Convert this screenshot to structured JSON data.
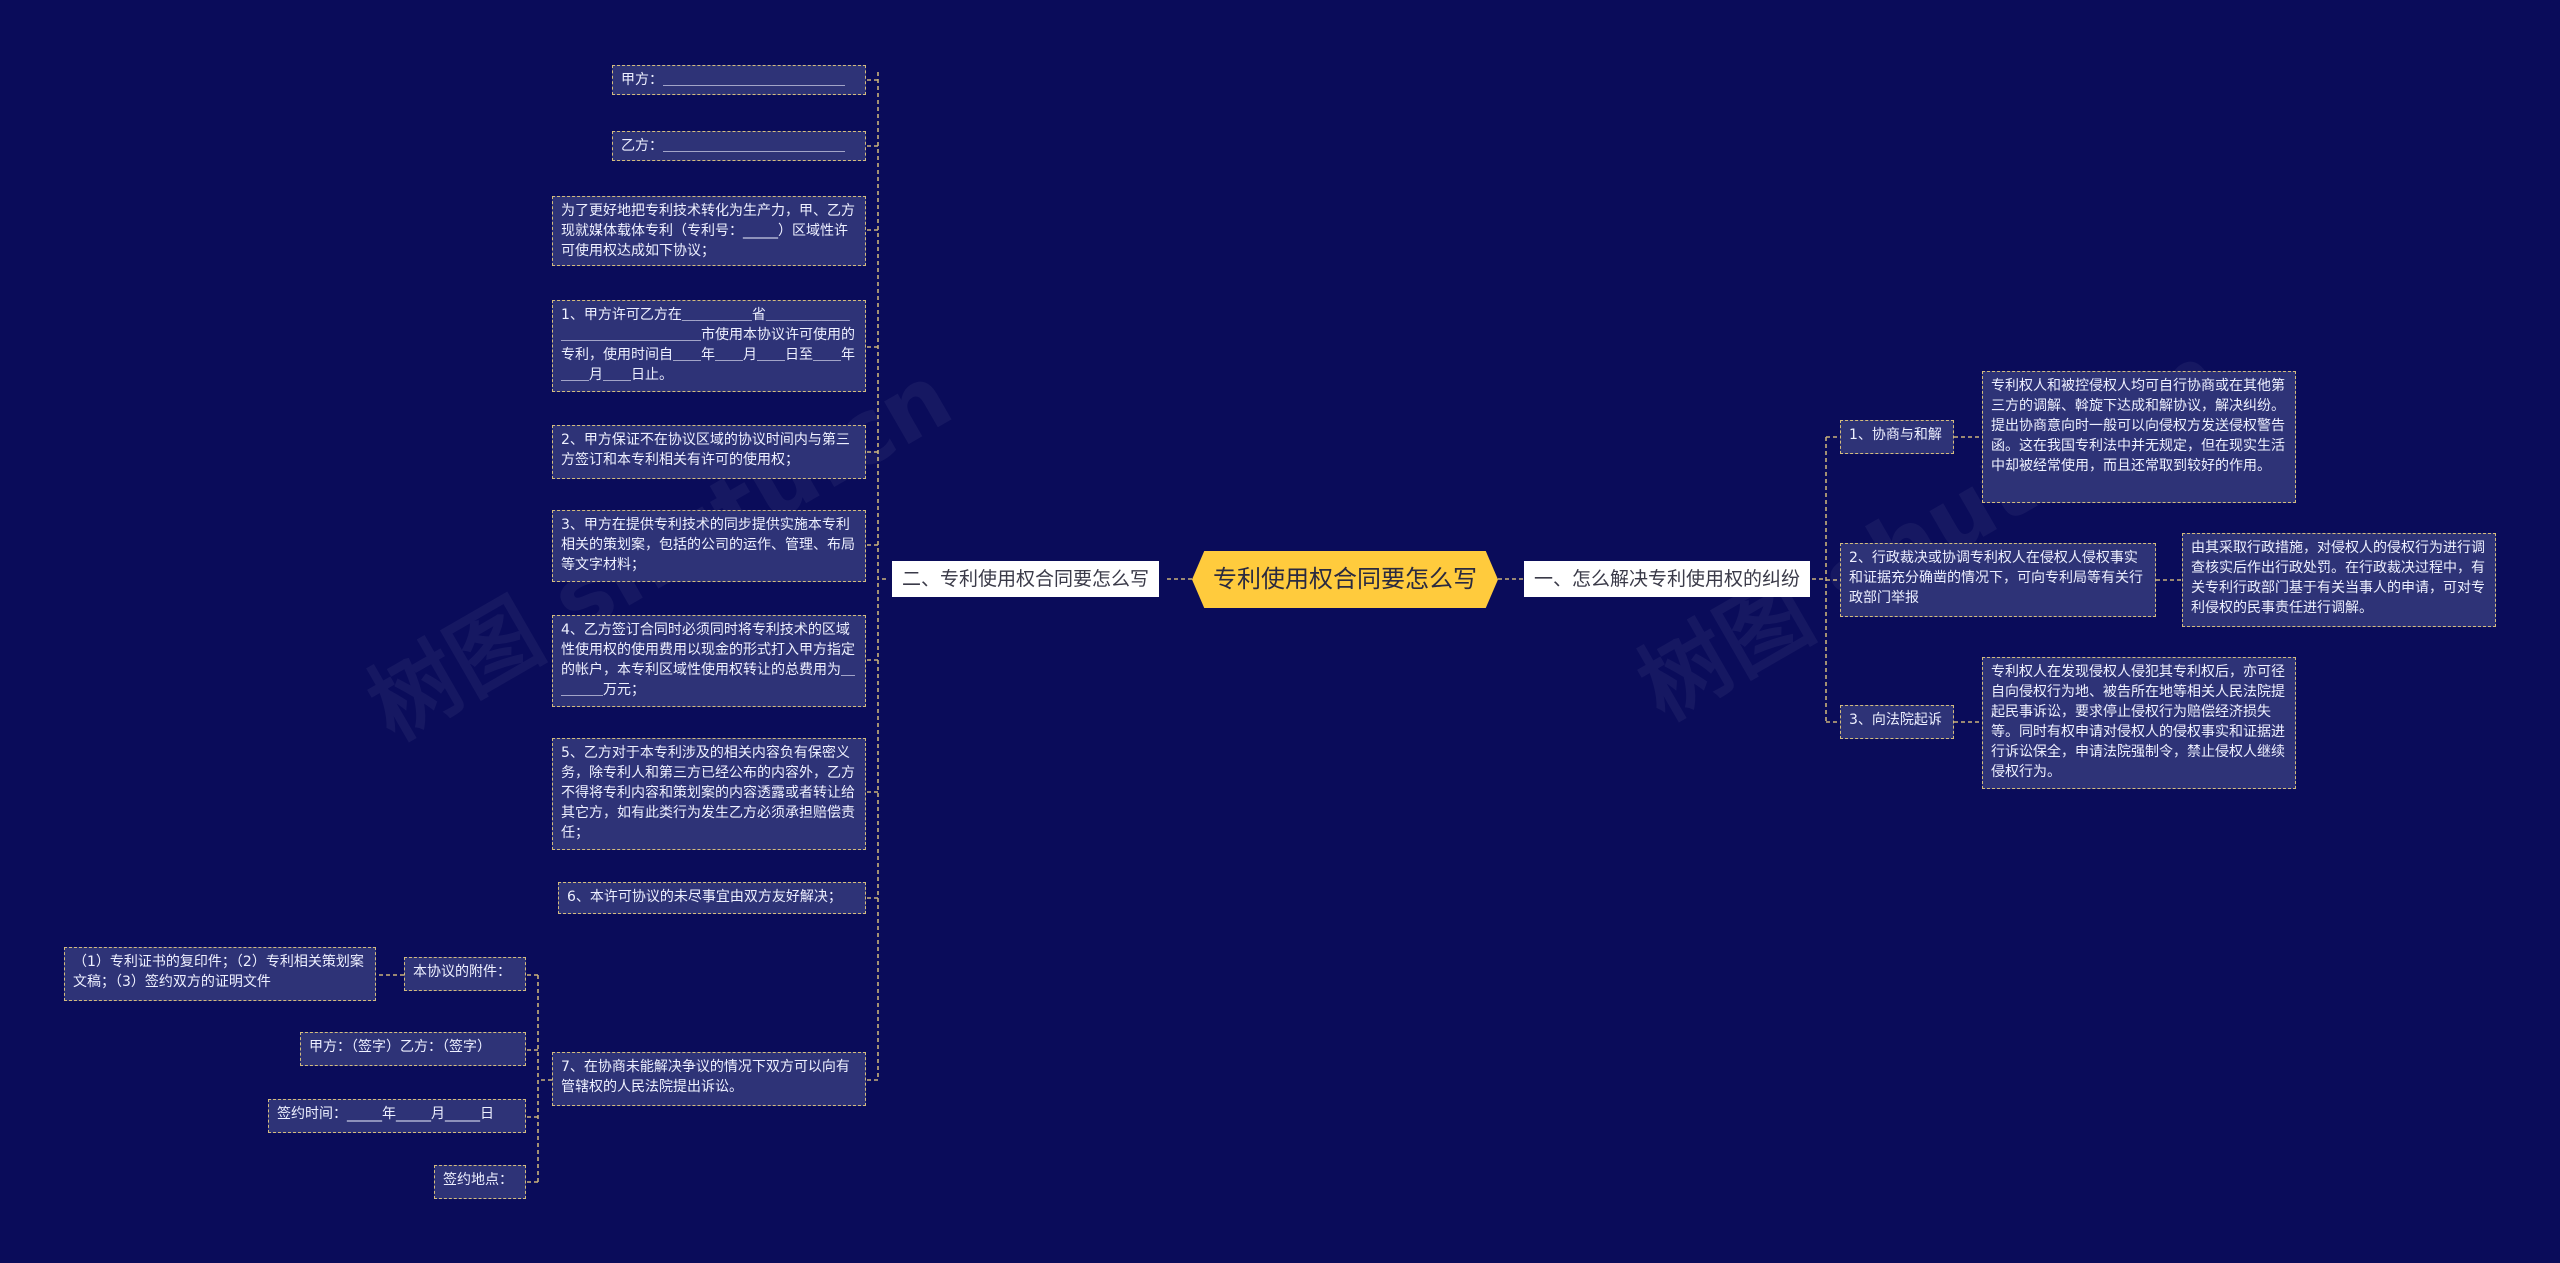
{
  "root": {
    "label": "专利使用权合同要怎么写"
  },
  "branches": {
    "left": {
      "label": "二、专利使用权合同要怎么写"
    },
    "right": {
      "label": "一、怎么解决专利使用权的纠纷"
    }
  },
  "left_nodes": [
    "甲方：＿＿＿＿＿＿＿＿＿＿＿＿＿",
    "乙方：＿＿＿＿＿＿＿＿＿＿＿＿＿",
    "为了更好地把专利技术转化为生产力，甲、乙方现就媒体载体专利（专利号：_____）区域性许可使用权达成如下协议；",
    "1、甲方许可乙方在＿＿＿＿＿省＿＿＿＿＿＿＿＿＿＿＿＿＿＿＿＿市使用本协议许可使用的专利，使用时间自＿＿年＿＿月＿＿日至＿＿年＿＿月＿＿日止。",
    "2、甲方保证不在协议区域的协议时间内与第三方签订和本专利相关有许可的使用权；",
    "3、甲方在提供专利技术的同步提供实施本专利相关的策划案，包括的公司的运作、管理、布局等文字材料；",
    "4、乙方签订合同时必须同时将专利技术的区域性使用权的使用费用以现金的形式打入甲方指定的帐户，本专利区域性使用权转让的总费用为＿＿＿＿万元；",
    "5、乙方对于本专利涉及的相关内容负有保密义务，除专利人和第三方已经公布的内容外，乙方不得将专利内容和策划案的内容透露或者转让给其它方，如有此类行为发生乙方必须承担赔偿责任；",
    "6、本许可协议的未尽事宜由双方友好解决；",
    "7、在协商未能解决争议的情况下双方可以向有管辖权的人民法院提出诉讼。"
  ],
  "sub_nodes": [
    "本协议的附件：",
    "甲方：（签字）乙方：（签字）",
    "签约时间：_____年_____月_____日",
    "签约地点："
  ],
  "attachment_detail": "（1）专利证书的复印件；（2）专利相关策划案文稿；（3）签约双方的证明文件",
  "right_nodes": [
    {
      "label": "1、协商与和解",
      "detail": "专利权人和被控侵权人均可自行协商或在其他第三方的调解、斡旋下达成和解协议，解决纠纷。提出协商意向时一般可以向侵权方发送侵权警告函。这在我国专利法中并无规定，但在现实生活中却被经常使用，而且还常取到较好的作用。"
    },
    {
      "label": "2、行政裁决或协调专利权人在侵权人侵权事实和证据充分确凿的情况下，可向专利局等有关行政部门举报",
      "detail": "由其采取行政措施，对侵权人的侵权行为进行调查核实后作出行政处罚。在行政裁决过程中，有关专利行政部门基于有关当事人的申请，可对专利侵权的民事责任进行调解。"
    },
    {
      "label": "3、向法院起诉",
      "detail": "专利权人在发现侵权人侵犯其专利权后，亦可径自向侵权行为地、被告所在地等相关人民法院提起民事诉讼，要求停止侵权行为赔偿经济损失等。同时有权申请对侵权人的侵权事实和证据进行诉讼保全，申请法院强制令，禁止侵权人继续侵权行为。"
    }
  ],
  "colors": {
    "background": "#0a0c5a",
    "root": "#ffcb3d",
    "node": "#2e3377",
    "border": "#d4bc7e",
    "line": "#c9b27a"
  },
  "icons": []
}
